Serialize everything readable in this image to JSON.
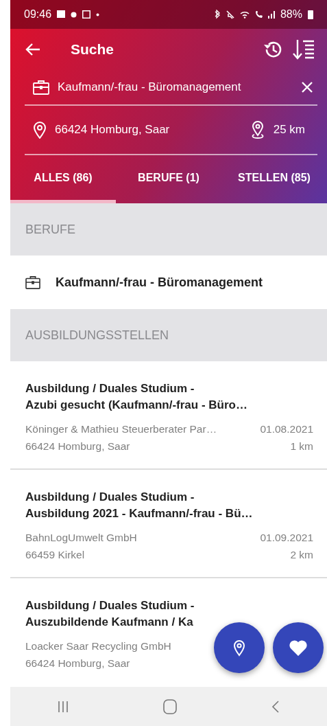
{
  "status_bar": {
    "time": "09:46",
    "battery": "88%"
  },
  "app_bar": {
    "title": "Suche"
  },
  "search": {
    "job_value": "Kaufmann/-frau - Büromanagement",
    "location_value": "66424 Homburg, Saar",
    "radius": "25 km"
  },
  "tabs": [
    {
      "label": "ALLES (86)",
      "selected": true
    },
    {
      "label": "BERUFE (1)",
      "selected": false
    },
    {
      "label": "STELLEN (85)",
      "selected": false
    }
  ],
  "sections": [
    {
      "kind": "jobs",
      "header": "BERUFE",
      "items": [
        {
          "title": "Kaufmann/-frau - Büromanagement"
        }
      ]
    },
    {
      "kind": "offers",
      "header": "AUSBILDUNGSSTELLEN",
      "items": [
        {
          "title_line_1": "Ausbildung / Duales Studium -",
          "title_line_2": "Azubi gesucht (Kaufmann/-frau - Büro…",
          "company": "Köninger & Mathieu Steuerberater  Par…",
          "date": "01.08.2021",
          "place": "66424 Homburg, Saar",
          "distance": "1 km"
        },
        {
          "title_line_1": "Ausbildung / Duales Studium -",
          "title_line_2": "Ausbildung 2021 - Kaufmann/-frau - Bü…",
          "company": "BahnLogUmwelt GmbH",
          "date": "01.09.2021",
          "place": "66459 Kirkel",
          "distance": "2 km"
        },
        {
          "title_line_1": "Ausbildung / Duales Studium -",
          "title_line_2": "Auszubildende Kaufmann / Ka",
          "company": "Loacker Saar Recycling GmbH",
          "place": "66424 Homburg, Saar"
        }
      ]
    }
  ]
}
